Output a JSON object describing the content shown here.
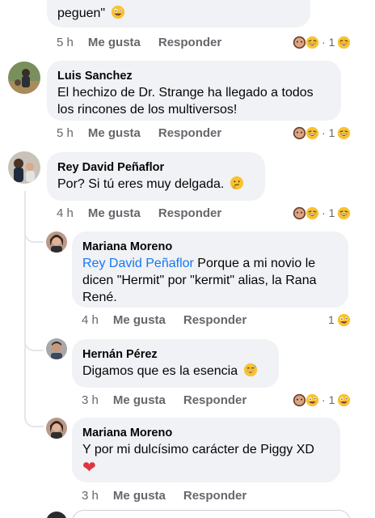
{
  "comments": [
    {
      "id": "c0",
      "text_end": "peguen\" ",
      "time": "5 h",
      "like_label": "Me gusta",
      "reply_label": "Responder",
      "reaction_count": "1",
      "reaction_dot": "·"
    },
    {
      "id": "c1",
      "author": "Luis Sanchez",
      "text": "El hechizo de Dr. Strange ha llegado a todos los rincones de los multiversos!",
      "time": "5 h",
      "like_label": "Me gusta",
      "reply_label": "Responder",
      "reaction_count": "1",
      "reaction_dot": "·"
    },
    {
      "id": "c2",
      "author": "Rey David Peñaflor",
      "text": "Por? Si tú eres muy delgada. ",
      "time": "4 h",
      "like_label": "Me gusta",
      "reply_label": "Responder",
      "reaction_count": "1",
      "reaction_dot": "·"
    }
  ],
  "replies": [
    {
      "id": "r1",
      "author": "Mariana Moreno",
      "mention": "Rey David Peñaflor",
      "text": " Porque a mi novio le dicen \"Hermit\" por \"kermit\" alias, la Rana René.",
      "time": "4 h",
      "like_label": "Me gusta",
      "reply_label": "Responder",
      "reaction_count": "1"
    },
    {
      "id": "r2",
      "author": "Hernán Pérez",
      "text": "Digamos que es la esencia ",
      "time": "3 h",
      "like_label": "Me gusta",
      "reply_label": "Responder",
      "reaction_count": "1",
      "reaction_dot": "·"
    },
    {
      "id": "r3",
      "author": "Mariana Moreno",
      "text": "Y por mi dulcísimo carácter de Piggy XD",
      "heart": "❤",
      "time": "3 h",
      "like_label": "Me gusta",
      "reply_label": "Responder"
    }
  ],
  "icons": {
    "laugh": "laughing-emoji-icon",
    "love": "heart-eyes-emoji-icon",
    "wink": "zany-emoji-icon",
    "heart": "red-heart-icon"
  },
  "colors": {
    "bubble": "#f0f2f5",
    "muted": "#65676b",
    "link": "#1877f2",
    "heart": "#e0343f"
  }
}
